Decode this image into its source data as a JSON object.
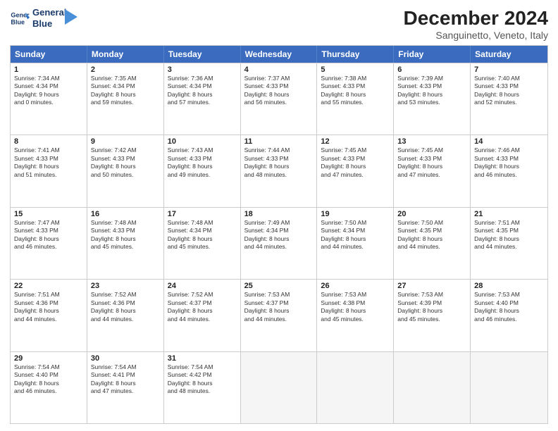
{
  "logo": {
    "line1": "General",
    "line2": "Blue"
  },
  "title": "December 2024",
  "subtitle": "Sanguinetto, Veneto, Italy",
  "headers": [
    "Sunday",
    "Monday",
    "Tuesday",
    "Wednesday",
    "Thursday",
    "Friday",
    "Saturday"
  ],
  "rows": [
    [
      {
        "day": "1",
        "lines": [
          "Sunrise: 7:34 AM",
          "Sunset: 4:34 PM",
          "Daylight: 9 hours",
          "and 0 minutes."
        ]
      },
      {
        "day": "2",
        "lines": [
          "Sunrise: 7:35 AM",
          "Sunset: 4:34 PM",
          "Daylight: 8 hours",
          "and 59 minutes."
        ]
      },
      {
        "day": "3",
        "lines": [
          "Sunrise: 7:36 AM",
          "Sunset: 4:34 PM",
          "Daylight: 8 hours",
          "and 57 minutes."
        ]
      },
      {
        "day": "4",
        "lines": [
          "Sunrise: 7:37 AM",
          "Sunset: 4:33 PM",
          "Daylight: 8 hours",
          "and 56 minutes."
        ]
      },
      {
        "day": "5",
        "lines": [
          "Sunrise: 7:38 AM",
          "Sunset: 4:33 PM",
          "Daylight: 8 hours",
          "and 55 minutes."
        ]
      },
      {
        "day": "6",
        "lines": [
          "Sunrise: 7:39 AM",
          "Sunset: 4:33 PM",
          "Daylight: 8 hours",
          "and 53 minutes."
        ]
      },
      {
        "day": "7",
        "lines": [
          "Sunrise: 7:40 AM",
          "Sunset: 4:33 PM",
          "Daylight: 8 hours",
          "and 52 minutes."
        ]
      }
    ],
    [
      {
        "day": "8",
        "lines": [
          "Sunrise: 7:41 AM",
          "Sunset: 4:33 PM",
          "Daylight: 8 hours",
          "and 51 minutes."
        ]
      },
      {
        "day": "9",
        "lines": [
          "Sunrise: 7:42 AM",
          "Sunset: 4:33 PM",
          "Daylight: 8 hours",
          "and 50 minutes."
        ]
      },
      {
        "day": "10",
        "lines": [
          "Sunrise: 7:43 AM",
          "Sunset: 4:33 PM",
          "Daylight: 8 hours",
          "and 49 minutes."
        ]
      },
      {
        "day": "11",
        "lines": [
          "Sunrise: 7:44 AM",
          "Sunset: 4:33 PM",
          "Daylight: 8 hours",
          "and 48 minutes."
        ]
      },
      {
        "day": "12",
        "lines": [
          "Sunrise: 7:45 AM",
          "Sunset: 4:33 PM",
          "Daylight: 8 hours",
          "and 47 minutes."
        ]
      },
      {
        "day": "13",
        "lines": [
          "Sunrise: 7:45 AM",
          "Sunset: 4:33 PM",
          "Daylight: 8 hours",
          "and 47 minutes."
        ]
      },
      {
        "day": "14",
        "lines": [
          "Sunrise: 7:46 AM",
          "Sunset: 4:33 PM",
          "Daylight: 8 hours",
          "and 46 minutes."
        ]
      }
    ],
    [
      {
        "day": "15",
        "lines": [
          "Sunrise: 7:47 AM",
          "Sunset: 4:33 PM",
          "Daylight: 8 hours",
          "and 46 minutes."
        ]
      },
      {
        "day": "16",
        "lines": [
          "Sunrise: 7:48 AM",
          "Sunset: 4:33 PM",
          "Daylight: 8 hours",
          "and 45 minutes."
        ]
      },
      {
        "day": "17",
        "lines": [
          "Sunrise: 7:48 AM",
          "Sunset: 4:34 PM",
          "Daylight: 8 hours",
          "and 45 minutes."
        ]
      },
      {
        "day": "18",
        "lines": [
          "Sunrise: 7:49 AM",
          "Sunset: 4:34 PM",
          "Daylight: 8 hours",
          "and 44 minutes."
        ]
      },
      {
        "day": "19",
        "lines": [
          "Sunrise: 7:50 AM",
          "Sunset: 4:34 PM",
          "Daylight: 8 hours",
          "and 44 minutes."
        ]
      },
      {
        "day": "20",
        "lines": [
          "Sunrise: 7:50 AM",
          "Sunset: 4:35 PM",
          "Daylight: 8 hours",
          "and 44 minutes."
        ]
      },
      {
        "day": "21",
        "lines": [
          "Sunrise: 7:51 AM",
          "Sunset: 4:35 PM",
          "Daylight: 8 hours",
          "and 44 minutes."
        ]
      }
    ],
    [
      {
        "day": "22",
        "lines": [
          "Sunrise: 7:51 AM",
          "Sunset: 4:36 PM",
          "Daylight: 8 hours",
          "and 44 minutes."
        ]
      },
      {
        "day": "23",
        "lines": [
          "Sunrise: 7:52 AM",
          "Sunset: 4:36 PM",
          "Daylight: 8 hours",
          "and 44 minutes."
        ]
      },
      {
        "day": "24",
        "lines": [
          "Sunrise: 7:52 AM",
          "Sunset: 4:37 PM",
          "Daylight: 8 hours",
          "and 44 minutes."
        ]
      },
      {
        "day": "25",
        "lines": [
          "Sunrise: 7:53 AM",
          "Sunset: 4:37 PM",
          "Daylight: 8 hours",
          "and 44 minutes."
        ]
      },
      {
        "day": "26",
        "lines": [
          "Sunrise: 7:53 AM",
          "Sunset: 4:38 PM",
          "Daylight: 8 hours",
          "and 45 minutes."
        ]
      },
      {
        "day": "27",
        "lines": [
          "Sunrise: 7:53 AM",
          "Sunset: 4:39 PM",
          "Daylight: 8 hours",
          "and 45 minutes."
        ]
      },
      {
        "day": "28",
        "lines": [
          "Sunrise: 7:53 AM",
          "Sunset: 4:40 PM",
          "Daylight: 8 hours",
          "and 46 minutes."
        ]
      }
    ],
    [
      {
        "day": "29",
        "lines": [
          "Sunrise: 7:54 AM",
          "Sunset: 4:40 PM",
          "Daylight: 8 hours",
          "and 46 minutes."
        ]
      },
      {
        "day": "30",
        "lines": [
          "Sunrise: 7:54 AM",
          "Sunset: 4:41 PM",
          "Daylight: 8 hours",
          "and 47 minutes."
        ]
      },
      {
        "day": "31",
        "lines": [
          "Sunrise: 7:54 AM",
          "Sunset: 4:42 PM",
          "Daylight: 8 hours",
          "and 48 minutes."
        ]
      },
      {
        "day": "",
        "lines": []
      },
      {
        "day": "",
        "lines": []
      },
      {
        "day": "",
        "lines": []
      },
      {
        "day": "",
        "lines": []
      }
    ]
  ]
}
